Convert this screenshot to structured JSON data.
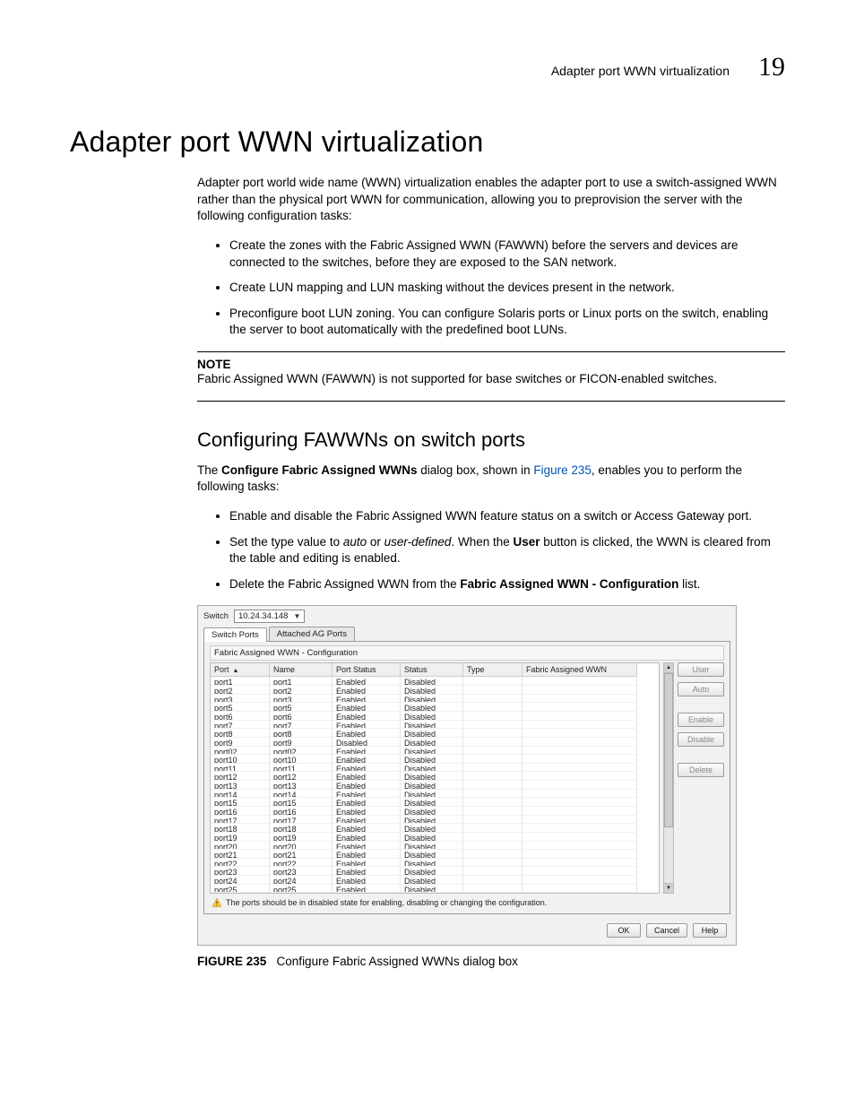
{
  "header": {
    "running": "Adapter port WWN virtualization",
    "chapter": "19"
  },
  "title": "Adapter port WWN virtualization",
  "intro": "Adapter port world wide name (WWN) virtualization enables the adapter port to use a switch-assigned WWN rather than the physical port WWN for communication, allowing you to preprovision the server with the following configuration tasks:",
  "bullets1": [
    "Create the zones with the Fabric Assigned WWN (FAWWN) before the servers and devices are connected to the switches, before they are exposed to the SAN network.",
    "Create LUN mapping and LUN masking without the devices present in the network.",
    "Preconfigure boot LUN zoning. You can configure Solaris ports or Linux ports on the switch, enabling the server to boot automatically with the predefined boot LUNs."
  ],
  "note": {
    "label": "NOTE",
    "text": "Fabric Assigned WWN (FAWWN) is not supported for base switches or FICON-enabled switches."
  },
  "sub1": {
    "title": "Configuring FAWWNs on switch ports",
    "p1a": "The ",
    "p1b": "Configure Fabric Assigned WWNs",
    "p1c": " dialog box, shown in ",
    "p1link": "Figure 235",
    "p1d": ", enables you to perform the following tasks:",
    "bullets": {
      "b1": "Enable and disable the Fabric Assigned WWN feature status on a switch or Access Gateway port.",
      "b2a": "Set the type value to ",
      "b2i1": "auto",
      "b2b": " or ",
      "b2i2": "user-defined",
      "b2c": ". When the ",
      "b2bold": "User",
      "b2d": " button is clicked, the WWN is cleared from the table and editing is enabled.",
      "b3a": "Delete the Fabric Assigned WWN from the ",
      "b3bold": "Fabric Assigned WWN - Configuration",
      "b3b": " list."
    }
  },
  "dialog": {
    "switch_label": "Switch",
    "switch_value": "10.24.34.148",
    "tabs": [
      "Switch Ports",
      "Attached AG Ports"
    ],
    "panel_title": "Fabric Assigned WWN - Configuration",
    "columns": [
      "Port",
      "Name",
      "Port Status",
      "Status",
      "Type",
      "Fabric Assigned WWN"
    ],
    "sort_glyph": "▲",
    "rows": [
      {
        "port": "port1",
        "name": "port1",
        "ps": "Enabled",
        "st": "Disabled",
        "ty": "",
        "fa": ""
      },
      {
        "port": "port2",
        "name": "port2",
        "ps": "Enabled",
        "st": "Disabled",
        "ty": "",
        "fa": ""
      },
      {
        "port": "port3",
        "name": "port3",
        "ps": "Enabled",
        "st": "Disabled",
        "ty": "",
        "fa": ""
      },
      {
        "port": "port5",
        "name": "port5",
        "ps": "Enabled",
        "st": "Disabled",
        "ty": "",
        "fa": ""
      },
      {
        "port": "port6",
        "name": "port6",
        "ps": "Enabled",
        "st": "Disabled",
        "ty": "",
        "fa": ""
      },
      {
        "port": "port7",
        "name": "port7",
        "ps": "Enabled",
        "st": "Disabled",
        "ty": "",
        "fa": ""
      },
      {
        "port": "port8",
        "name": "port8",
        "ps": "Enabled",
        "st": "Disabled",
        "ty": "",
        "fa": ""
      },
      {
        "port": "port9",
        "name": "port9",
        "ps": "Disabled",
        "st": "Disabled",
        "ty": "",
        "fa": ""
      },
      {
        "port": "port02",
        "name": "port02",
        "ps": "Enabled",
        "st": "Disabled",
        "ty": "",
        "fa": ""
      },
      {
        "port": "port10",
        "name": "port10",
        "ps": "Enabled",
        "st": "Disabled",
        "ty": "",
        "fa": ""
      },
      {
        "port": "port11",
        "name": "port11",
        "ps": "Enabled",
        "st": "Disabled",
        "ty": "",
        "fa": ""
      },
      {
        "port": "port12",
        "name": "port12",
        "ps": "Enabled",
        "st": "Disabled",
        "ty": "",
        "fa": ""
      },
      {
        "port": "port13",
        "name": "port13",
        "ps": "Enabled",
        "st": "Disabled",
        "ty": "",
        "fa": ""
      },
      {
        "port": "port14",
        "name": "port14",
        "ps": "Enabled",
        "st": "Disabled",
        "ty": "",
        "fa": ""
      },
      {
        "port": "port15",
        "name": "port15",
        "ps": "Enabled",
        "st": "Disabled",
        "ty": "",
        "fa": ""
      },
      {
        "port": "port16",
        "name": "port16",
        "ps": "Enabled",
        "st": "Disabled",
        "ty": "",
        "fa": ""
      },
      {
        "port": "port17",
        "name": "port17",
        "ps": "Enabled",
        "st": "Disabled",
        "ty": "",
        "fa": ""
      },
      {
        "port": "port18",
        "name": "port18",
        "ps": "Enabled",
        "st": "Disabled",
        "ty": "",
        "fa": ""
      },
      {
        "port": "port19",
        "name": "port19",
        "ps": "Enabled",
        "st": "Disabled",
        "ty": "",
        "fa": ""
      },
      {
        "port": "port20",
        "name": "port20",
        "ps": "Enabled",
        "st": "Disabled",
        "ty": "",
        "fa": ""
      },
      {
        "port": "port21",
        "name": "port21",
        "ps": "Enabled",
        "st": "Disabled",
        "ty": "",
        "fa": ""
      },
      {
        "port": "port22",
        "name": "port22",
        "ps": "Enabled",
        "st": "Disabled",
        "ty": "",
        "fa": ""
      },
      {
        "port": "port23",
        "name": "port23",
        "ps": "Enabled",
        "st": "Disabled",
        "ty": "",
        "fa": ""
      },
      {
        "port": "port24",
        "name": "port24",
        "ps": "Enabled",
        "st": "Disabled",
        "ty": "",
        "fa": ""
      },
      {
        "port": "port25",
        "name": "port25",
        "ps": "Enabled",
        "st": "Disabled",
        "ty": "",
        "fa": ""
      }
    ],
    "side_buttons": {
      "user": "User",
      "auto": "Auto",
      "enable": "Enable",
      "disable": "Disable",
      "delete": "Delete"
    },
    "warning": "The ports should be in disabled state for enabling, disabling or changing the configuration.",
    "footer": {
      "ok": "OK",
      "cancel": "Cancel",
      "help": "Help"
    }
  },
  "figure": {
    "prefix": "FIGURE 235",
    "caption": "Configure Fabric Assigned WWNs dialog box"
  }
}
